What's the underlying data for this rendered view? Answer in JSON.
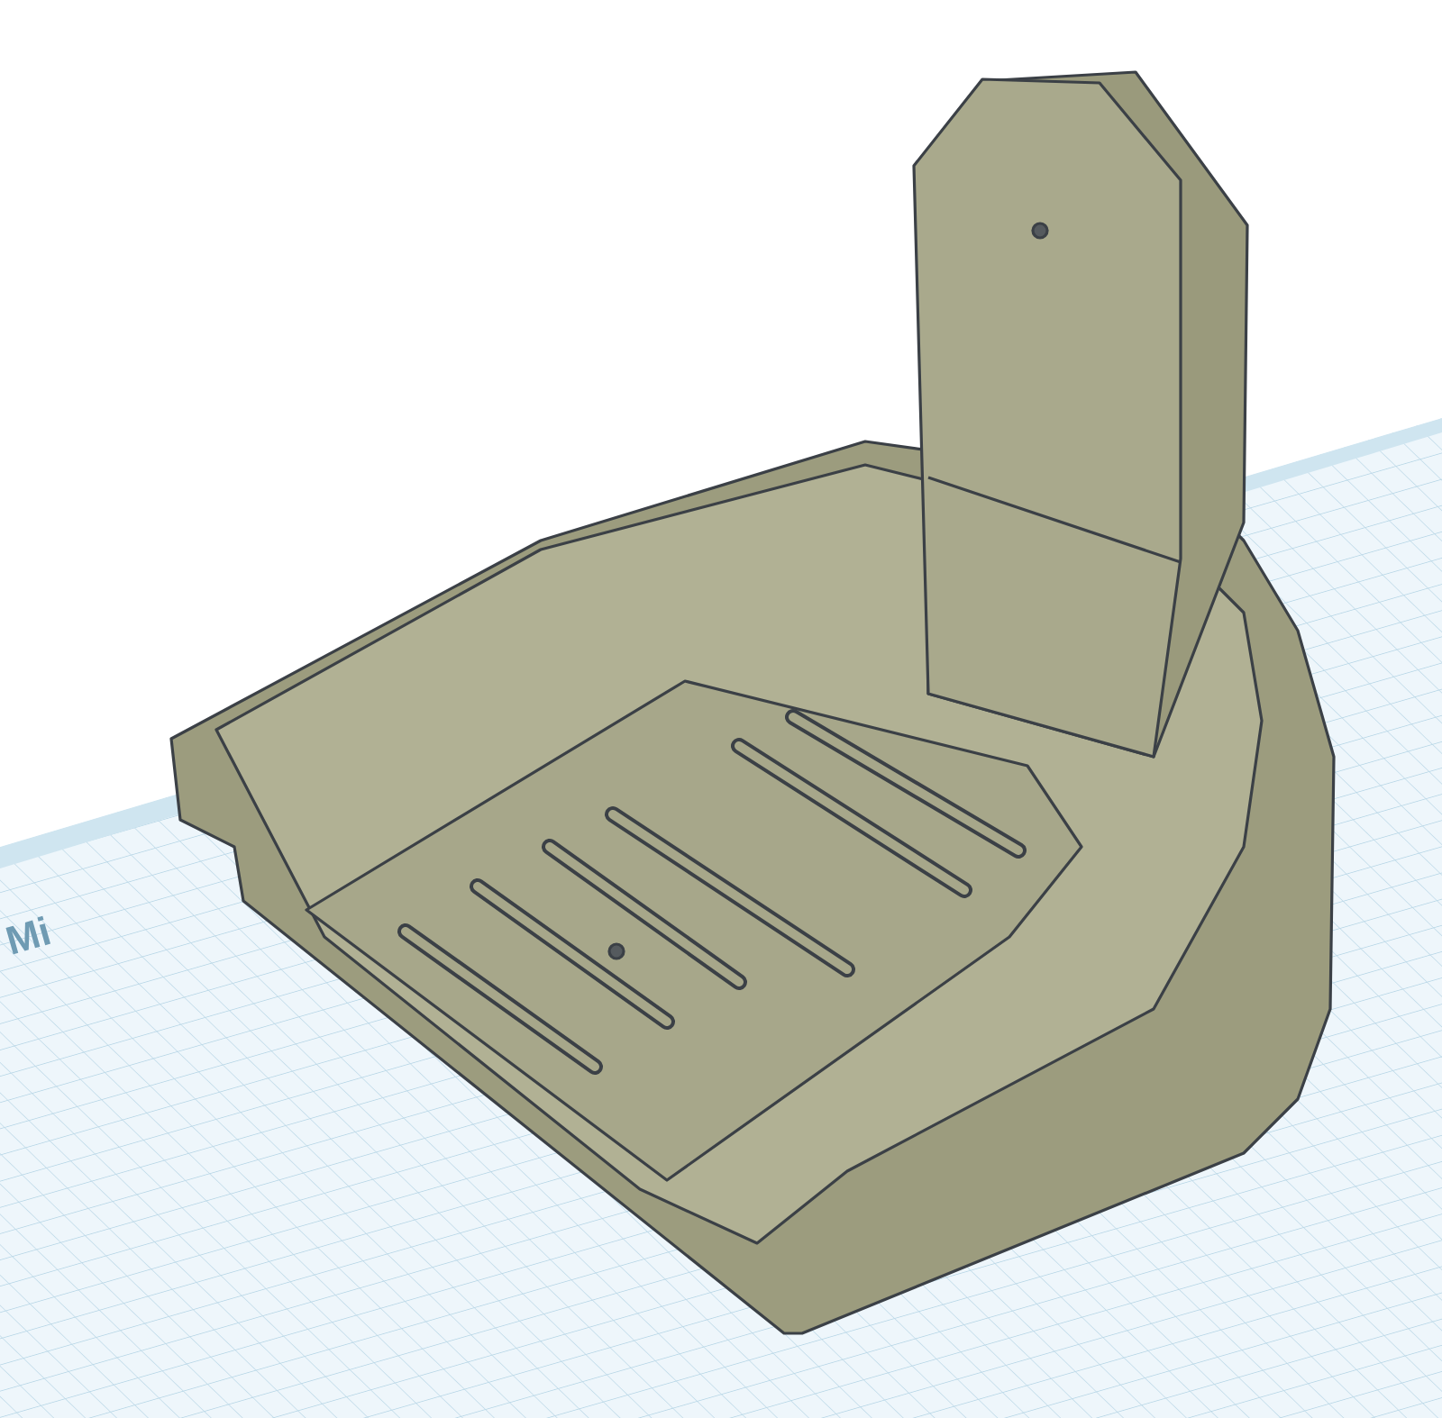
{
  "workplane": {
    "edge_label": "Mi"
  }
}
